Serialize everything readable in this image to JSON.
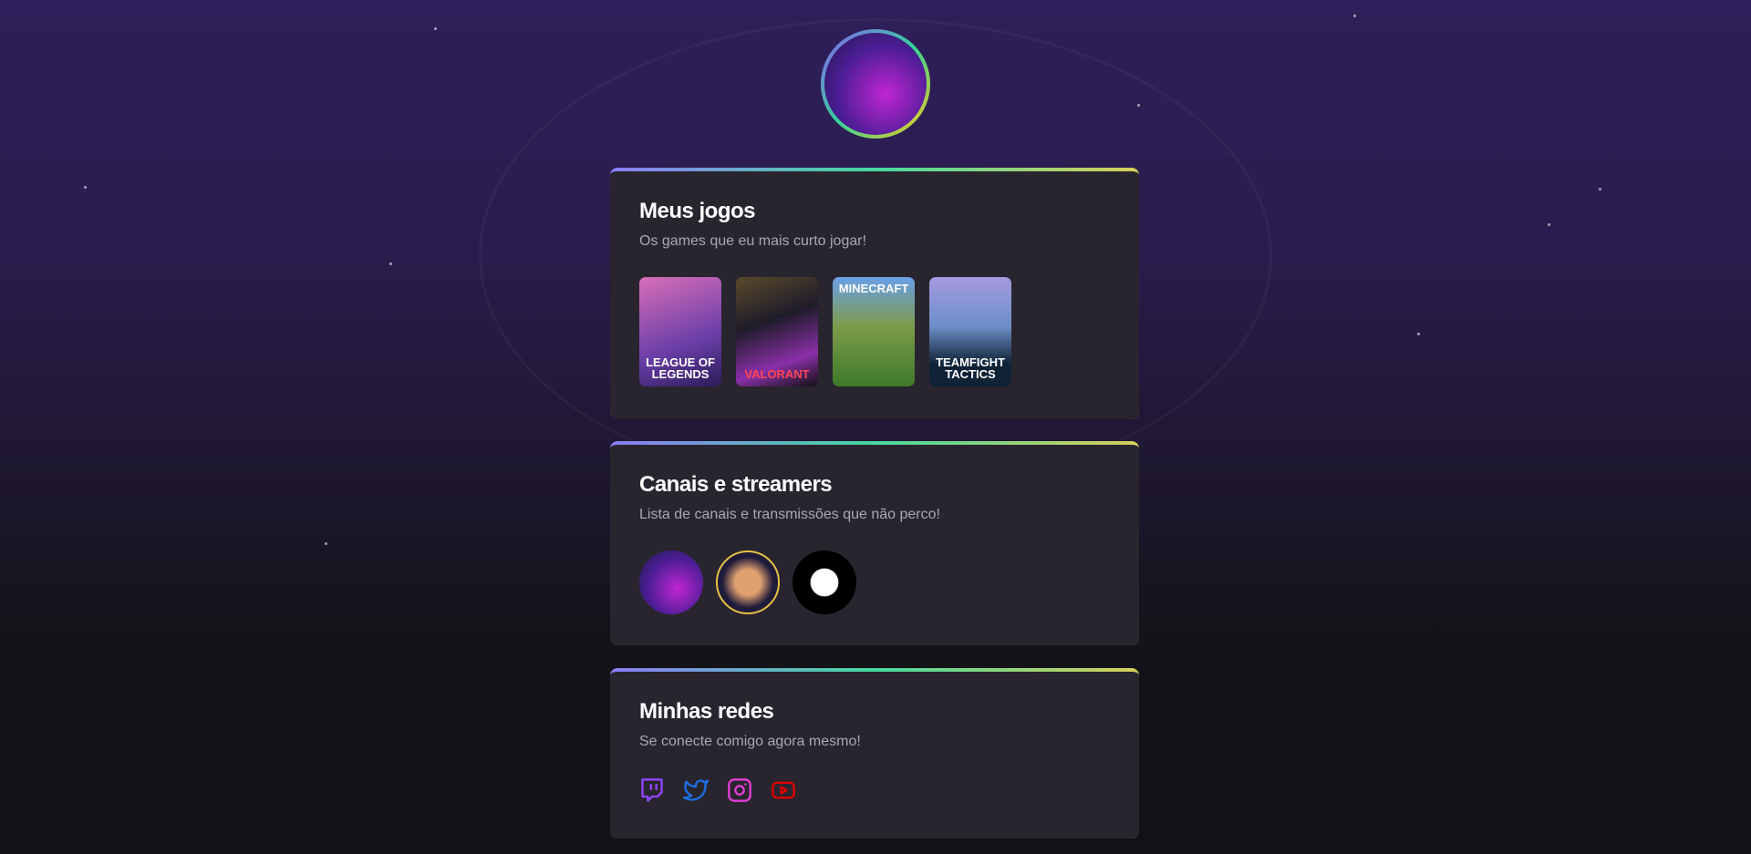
{
  "sections": [
    {
      "title": "Meus jogos",
      "subtitle": "Os games que eu mais curto jogar!"
    },
    {
      "title": "Canais e streamers",
      "subtitle": "Lista de canais e transmissões que não perco!"
    },
    {
      "title": "Minhas redes",
      "subtitle": "Se conecte comigo agora mesmo!"
    }
  ],
  "games": [
    {
      "name": "LEAGUE OF LEGENDS"
    },
    {
      "name": "VALORANT"
    },
    {
      "name": "MINECRAFT"
    },
    {
      "name": "TEAMFIGHT TACTICS"
    }
  ],
  "socials": {
    "twitch": "#9146ff",
    "twitter": "#1d6fe6",
    "instagram": "#e23fd6",
    "youtube": "#e00000"
  }
}
